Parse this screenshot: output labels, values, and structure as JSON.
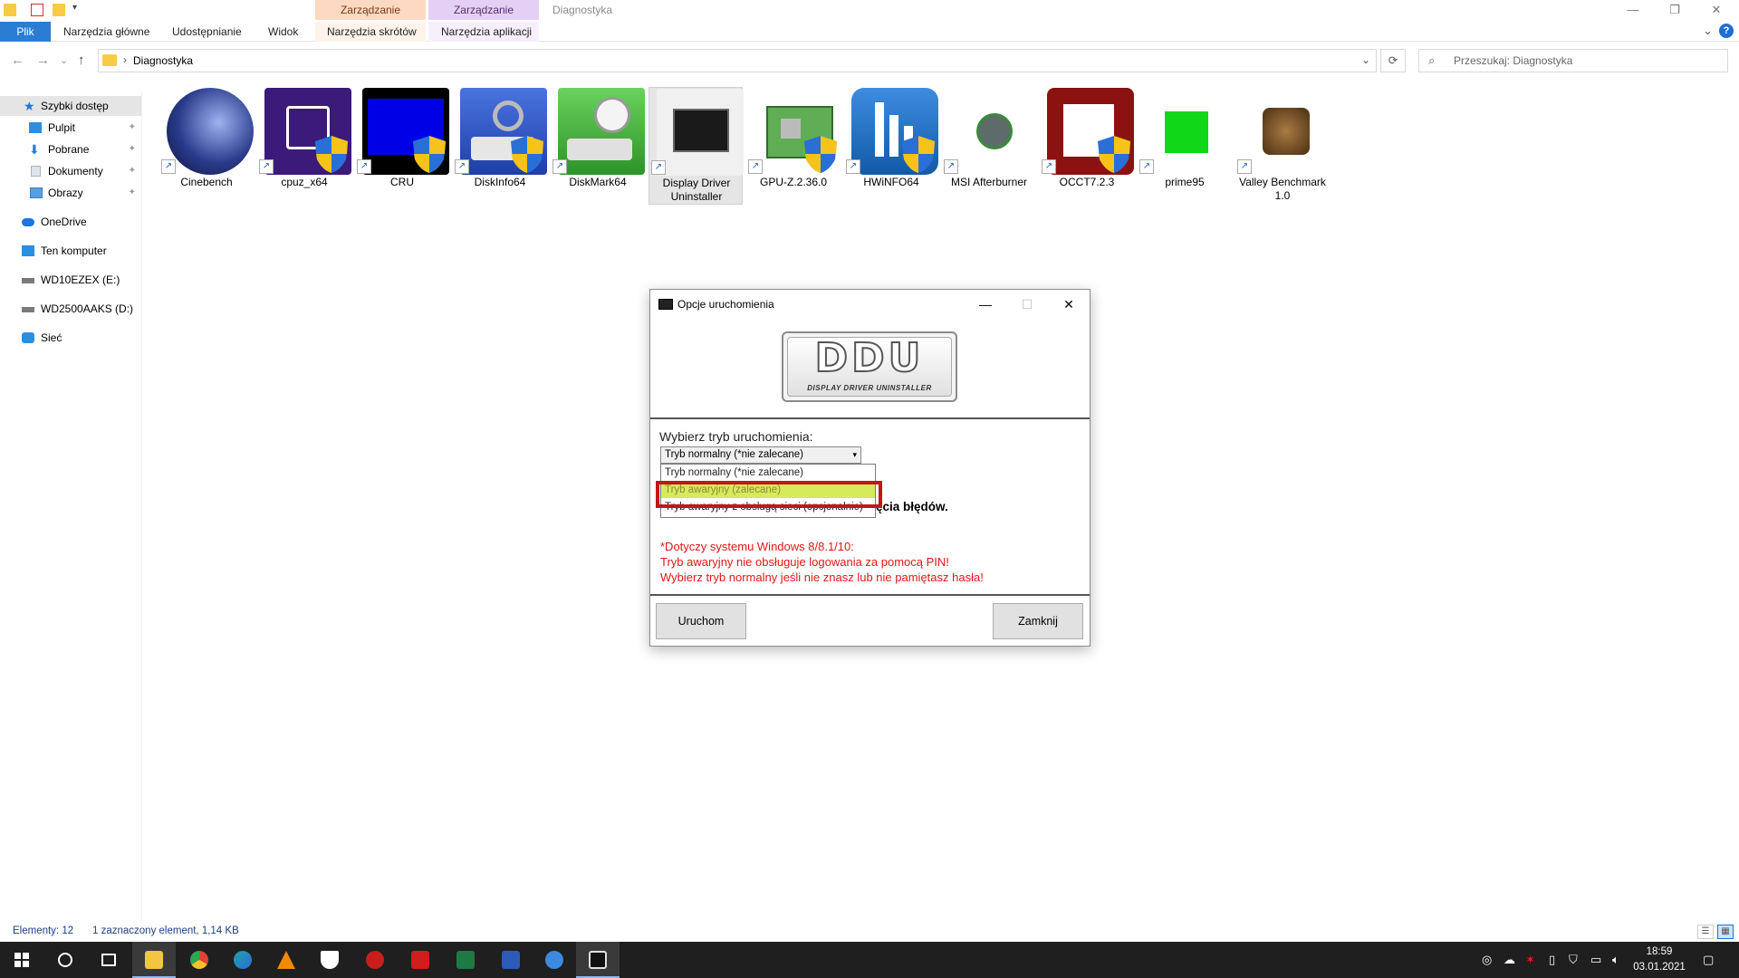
{
  "titlebar": {
    "context_shortcut_group": "Zarządzanie",
    "context_app_group": "Zarządzanie",
    "window_title": "Diagnostyka",
    "minimize": "—",
    "restore": "❐",
    "close": "✕"
  },
  "ribbon": {
    "tabs": [
      {
        "label": "Plik"
      },
      {
        "label": "Narzędzia główne"
      },
      {
        "label": "Udostępnianie"
      },
      {
        "label": "Widok"
      },
      {
        "label": "Narzędzia skrótów"
      },
      {
        "label": "Narzędzia aplikacji"
      }
    ],
    "collapse": "⌄",
    "help": "?"
  },
  "navigation": {
    "back": "←",
    "forward": "→",
    "recent": "⌄",
    "up": "↑",
    "breadcrumb_sep": "›",
    "breadcrumb": "Diagnostyka",
    "address_dropdown": "⌄",
    "refresh": "⟳",
    "search_placeholder": "Przeszukaj: Diagnostyka"
  },
  "sidebar": {
    "items": [
      {
        "label": "Szybki dostęp",
        "icon": "star-icon",
        "color": "#1e78d7"
      },
      {
        "label": "Pulpit",
        "icon": "desktop-icon",
        "color": "#2b8fe0",
        "pinned": true
      },
      {
        "label": "Pobrane",
        "icon": "download-icon",
        "color": "#2b7cd3",
        "pinned": true
      },
      {
        "label": "Dokumenty",
        "icon": "documents-icon",
        "color": "#a9b4c2",
        "pinned": true
      },
      {
        "label": "Obrazy",
        "icon": "pictures-icon",
        "color": "#5aa0e0",
        "pinned": true
      },
      {
        "label": "OneDrive",
        "icon": "cloud-icon",
        "color": "#1a73e8"
      },
      {
        "label": "Ten komputer",
        "icon": "computer-icon",
        "color": "#2b8fe0"
      },
      {
        "label": "WD10EZEX (E:)",
        "icon": "drive-icon",
        "color": "#7a7a7a"
      },
      {
        "label": "WD2500AAKS (D:)",
        "icon": "drive-icon",
        "color": "#7a7a7a"
      },
      {
        "label": "Sieć",
        "icon": "network-icon",
        "color": "#2b8fe0"
      }
    ],
    "pin_glyph": "📌"
  },
  "files": [
    {
      "label": "Cinebench",
      "icon": "cinebench-icon",
      "color": "#1b2a6b",
      "shield": false
    },
    {
      "label": "cpuz_x64",
      "icon": "cpuz-icon",
      "color": "#3c1a7a",
      "shield": true
    },
    {
      "label": "CRU",
      "icon": "monitor-icon",
      "color": "#0000e6",
      "shield": true
    },
    {
      "label": "DiskInfo64",
      "icon": "diskinfo-icon",
      "color": "#2f55c8",
      "shield": true
    },
    {
      "label": "DiskMark64",
      "icon": "diskmark-icon",
      "color": "#3fae3a",
      "shield": false
    },
    {
      "label": "Display Driver Uninstaller",
      "icon": "ddu-icon",
      "color": "#202020",
      "shield": false,
      "selected": true
    },
    {
      "label": "GPU-Z.2.36.0",
      "icon": "gpuz-icon",
      "color": "#4f9d4a",
      "shield": true
    },
    {
      "label": "HWiNFO64",
      "icon": "hwinfo-icon",
      "color": "#1f6fbf",
      "shield": true
    },
    {
      "label": "MSI Afterburner",
      "icon": "afterburner-icon",
      "color": "#5d6b6b",
      "shield": false
    },
    {
      "label": "OCCT7.2.3",
      "icon": "occt-icon",
      "color": "#8c1111",
      "shield": true
    },
    {
      "label": "prime95",
      "icon": "prime95-icon",
      "color": "#10d818",
      "shield": false
    },
    {
      "label": "Valley Benchmark 1.0",
      "icon": "valley-icon",
      "color": "#6e4a22",
      "shield": false
    }
  ],
  "dialog": {
    "title": "Opcje uruchomienia",
    "minimize": "—",
    "maximize": "☐",
    "close": "✕",
    "logo_big": "DDU",
    "logo_small": "DISPLAY DRIVER UNINSTALLER",
    "mode_label": "Wybierz tryb uruchomienia:",
    "mode_selected": "Tryb normalny (*nie zalecane)",
    "mode_arrow": "▾",
    "options": [
      "Tryb normalny (*nie zalecane)",
      "Tryb awaryjny (zalecane)",
      "Tryb awaryjny z obsługą sieci (opcjonalnie)"
    ],
    "info_bold": "ęcia błędów.",
    "warning_lines": [
      "*Dotyczy systemu Windows 8/8.1/10:",
      "Tryb awaryjny nie obsługuje logowania za pomocą PIN!",
      "Wybierz tryb normalny jeśli nie znasz lub nie pamiętasz hasła!"
    ],
    "run_button": "Uruchom",
    "close_button": "Zamknij",
    "highlight_color": "#d7ea5a",
    "warning_color": "#e01818"
  },
  "statusbar": {
    "count": "Elementy: 12",
    "selection": "1 zaznaczony element, 1,14 KB"
  },
  "taskbar": {
    "apps": [
      {
        "icon": "windows-start-icon",
        "color": "#ffffff"
      },
      {
        "icon": "search-circle-icon",
        "color": "#ffffff"
      },
      {
        "icon": "task-view-icon",
        "color": "#ffffff"
      },
      {
        "icon": "file-explorer-icon",
        "color": "#f4c542"
      },
      {
        "icon": "chrome-icon",
        "color": "#e44134"
      },
      {
        "icon": "edge-icon",
        "color": "#1fa0a8"
      },
      {
        "icon": "vlc-icon",
        "color": "#f08a00"
      },
      {
        "icon": "wolf-icon",
        "color": "#ffffff"
      },
      {
        "icon": "bug-icon",
        "color": "#c81e1e"
      },
      {
        "icon": "acrobat-icon",
        "color": "#d01e1e"
      },
      {
        "icon": "excel-icon",
        "color": "#1d7a45"
      },
      {
        "icon": "word-icon",
        "color": "#2b5bb7"
      },
      {
        "icon": "network-tool-icon",
        "color": "#3c8ae0"
      },
      {
        "icon": "ddu-taskbar-icon",
        "color": "#e0e0e0"
      }
    ],
    "time": "18:59",
    "date": "03.01.2021"
  }
}
